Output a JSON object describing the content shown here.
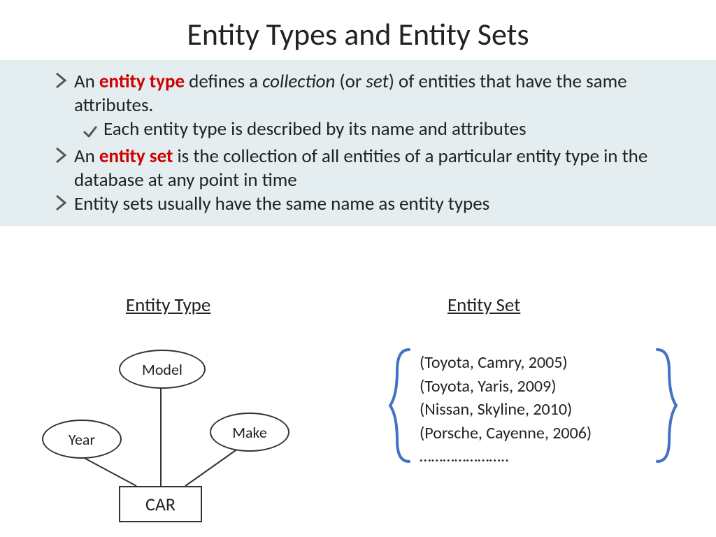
{
  "title": "Entity Types and Entity Sets",
  "bullets": {
    "b1_pre": "An ",
    "b1_red": "entity type",
    "b1_mid": " defines a ",
    "b1_ital": "collection",
    "b1_mid2": " (or ",
    "b1_ital2": "set",
    "b1_post": ") of entities that have the same attributes.",
    "b1a": "Each entity type is described by its name and attributes",
    "b2_pre": "An ",
    "b2_red": "entity set",
    "b2_post": " is the collection of all entities of a particular entity type in the database at any point in time",
    "b3": "Entity sets usually have the same name as entity types"
  },
  "columns": {
    "left": "Entity Type",
    "right": "Entity Set"
  },
  "er": {
    "model": "Model",
    "year": "Year",
    "make": "Make",
    "car": "CAR"
  },
  "set": {
    "r1": "(Toyota, Camry, 2005)",
    "r2": "(Toyota, Yaris, 2009)",
    "r3": "(Nissan, Skyline, 2010)",
    "r4": "(Porsche, Cayenne, 2006)",
    "r5": "…………………..",
    "brace_color": "#4472c4"
  }
}
